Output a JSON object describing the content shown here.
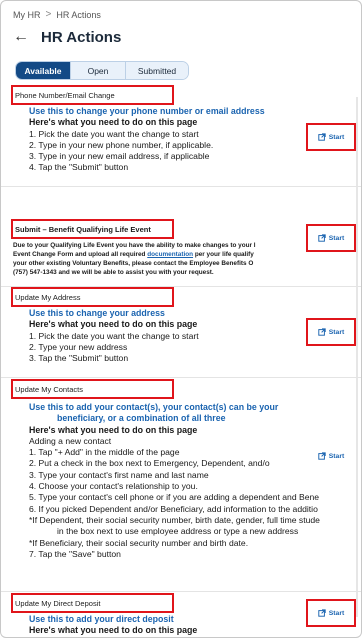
{
  "breadcrumb": {
    "root": "My HR",
    "separator": ">",
    "current": "HR Actions"
  },
  "page": {
    "title": "HR Actions",
    "back_icon": "arrow-left-icon"
  },
  "tabs": [
    {
      "label": "Available",
      "active": true
    },
    {
      "label": "Open",
      "active": false
    },
    {
      "label": "Submitted",
      "active": false
    }
  ],
  "colors": {
    "primary": "#134a86",
    "link": "#1b64b0",
    "highlight": "#e0151b"
  },
  "start_label": "Start",
  "start_icon": "external-link-icon",
  "sections": {
    "phone": {
      "title": "Phone Number/Email Change",
      "lines": [
        "Use this to change your phone number or email address",
        "Here's what you need to do on this page",
        "1. Pick the date you want the change to start",
        "2. Type in your new phone number, if applicable.",
        "3. Type in your new email address, if applicable",
        "4. Tap the \"Submit\" button"
      ]
    },
    "benefit": {
      "title": "Submit – Benefit Qualifying Life Event",
      "line1": "Due to your Qualifying Life Event you have the ability to make changes to your l",
      "line2_pre": "Event Change Form and upload all required ",
      "line2_link": "documentation",
      "line2_post": " per your life qualify",
      "line3": "your other existing Voluntary Benefits, please contact the Employee Benefits O",
      "line4": "(757) 547-1343 and we will be able to assist you with your request."
    },
    "address": {
      "title": "Update My Address",
      "lines": [
        "Use this to change your address",
        "Here's what you need to do on this page",
        "1. Pick the date you want the change to start",
        "2. Type your new address",
        "3. Tap the \"Submit\" button"
      ]
    },
    "contacts": {
      "title": "Update My Contacts",
      "lines": [
        "Use this to add your contact(s), your contact(s) can be your",
        "beneficiary, or a combination of all three",
        "Here's what you need to do on this page",
        "Adding a new contact",
        "1. Tap \"+ Add\" in the middle of the page",
        "2. Put a check in the box next to Emergency, Dependent, and/o",
        "3. Type your contact's first name and last name",
        "4. Choose your contact's relationship to you.",
        "5. Type your  contact's cell phone or if you are adding a dependent and Bene",
        "6. If you picked Dependent and/or Beneficiary, add information to the additio",
        "*If Dependent, their social security number, birth date, gender, full time stude",
        "in the box next to use employee address or type a new address",
        "*If Beneficiary, their social security number and birth date.",
        "7. Tap the \"Save\" button"
      ]
    },
    "deposit": {
      "title": "Update My Direct Deposit",
      "lines": [
        "Use this to add your direct deposit",
        "Here's what you need to do on this page"
      ]
    }
  }
}
